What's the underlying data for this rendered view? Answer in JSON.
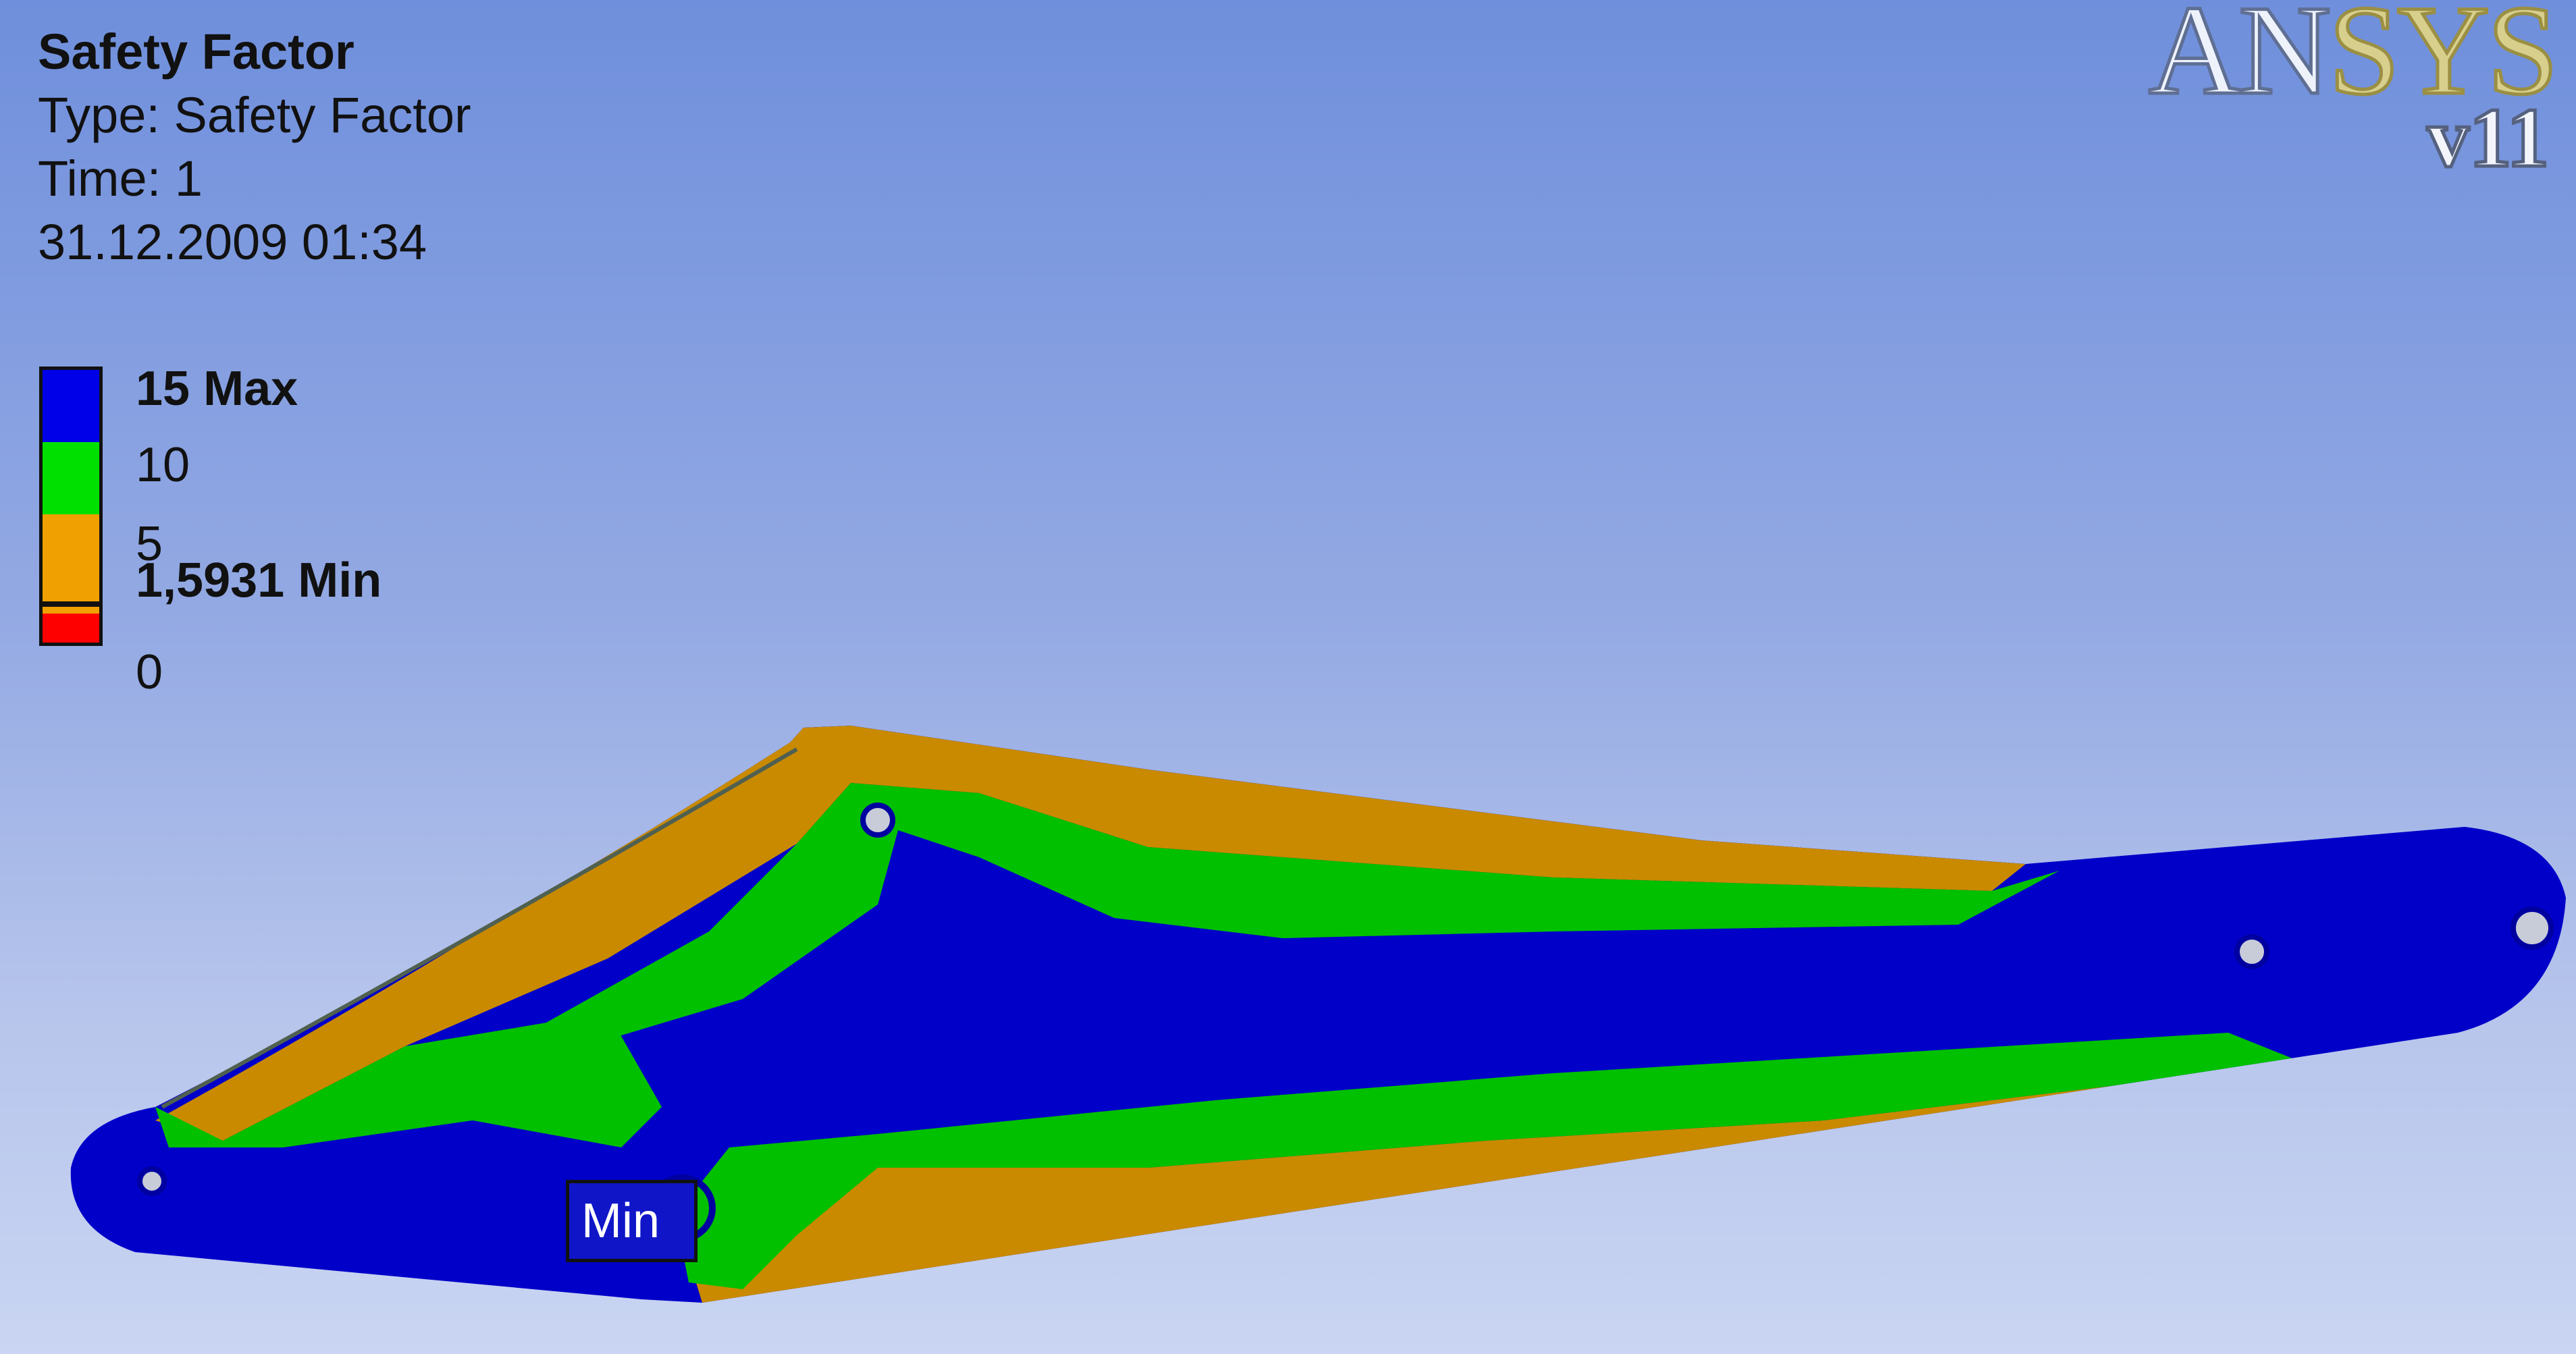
{
  "result": {
    "title": "Safety Factor",
    "type": "Type: Safety Factor",
    "time": "Time: 1",
    "date": "31.12.2009 01:34"
  },
  "legend": {
    "max_label": "15 Max",
    "label_10": "10",
    "label_5": "5",
    "min_label": "1,5931 Min",
    "label_0": "0",
    "colors": {
      "max_to_10": "#0000e8",
      "10_to_5": "#00e000",
      "5_to_min": "#f0a000",
      "min_line": "#000000",
      "below_min": "#ff0000"
    }
  },
  "logo": {
    "brand_white": "AN",
    "brand_gold": "SYS",
    "version": "v11"
  },
  "model": {
    "min_tag": "Min",
    "colors": {
      "blue": "#0000c8",
      "green": "#00c000",
      "orange": "#c98a00"
    }
  }
}
